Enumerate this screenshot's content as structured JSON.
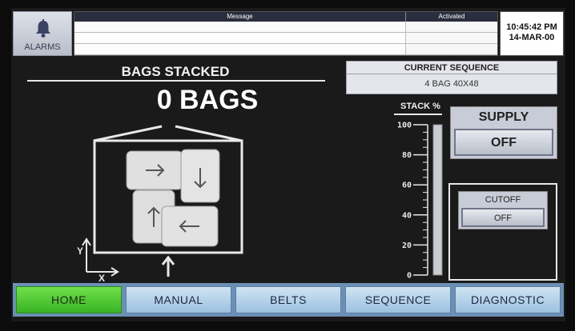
{
  "alarms": {
    "label": "ALARMS",
    "icon": "bell-icon"
  },
  "alarm_table": {
    "columns": [
      "Message",
      "Activated"
    ],
    "rows": [
      [
        "",
        ""
      ],
      [
        "",
        ""
      ],
      [
        "",
        ""
      ]
    ]
  },
  "clock": {
    "time": "10:45:42 PM",
    "date": "14-MAR-00"
  },
  "bags_stacked": {
    "title": "BAGS STACKED",
    "value": "0 BAGS"
  },
  "pallet": {
    "icons": [
      "x-axis-arrow-icon",
      "y-axis-arrow-icon",
      "up-arrow-icon"
    ],
    "axis_labels": {
      "x": "X",
      "y": "Y"
    }
  },
  "current_sequence": {
    "label": "CURRENT SEQUENCE",
    "value": "4 BAG 40X48"
  },
  "stack_percent": {
    "label": "STACK %",
    "value_percent": 0,
    "ticks": [
      "100",
      "80",
      "60",
      "40",
      "20",
      "0"
    ]
  },
  "supply": {
    "label": "SUPPLY",
    "state": "OFF"
  },
  "cutoff": {
    "label": "CUTOFF",
    "state": "OFF"
  },
  "nav": {
    "active": "HOME",
    "tabs": [
      {
        "label": "HOME"
      },
      {
        "label": "MANUAL"
      },
      {
        "label": "BELTS"
      },
      {
        "label": "SEQUENCE"
      },
      {
        "label": "DIAGNOSTIC"
      }
    ]
  },
  "colors": {
    "active_tab": "#39b324",
    "tab": "#b5d6ec",
    "nav_bar": "#6c8fb5",
    "background": "#1a1a1a"
  }
}
